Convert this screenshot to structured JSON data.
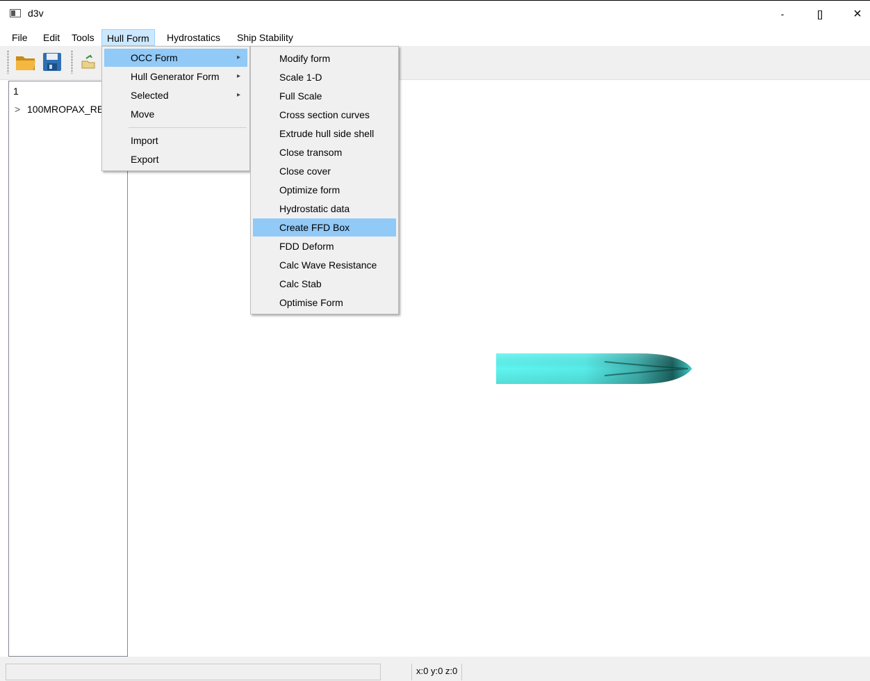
{
  "window": {
    "title": "d3v",
    "minimize": "-",
    "maximize": "[]",
    "close": "×"
  },
  "menubar": [
    "File",
    "Edit",
    "Tools",
    "Hull Form",
    "Hydrostatics",
    "Ship Stability"
  ],
  "tree": {
    "header": "1",
    "root_label": "100MROPAX_RE",
    "root_arrow": ">"
  },
  "hull_form_menu": {
    "items": [
      {
        "label": "OCC Form",
        "submenu": "▸"
      },
      {
        "label": "Hull Generator Form",
        "submenu": "▸"
      },
      {
        "label": "Selected",
        "submenu": "▸"
      },
      {
        "label": "Move"
      },
      {
        "label": "Import"
      },
      {
        "label": "Export"
      }
    ]
  },
  "occ_form_menu": {
    "items": [
      "Modify form",
      "Scale 1-D",
      "Full Scale",
      "Cross section curves",
      "Extrude hull side shell",
      "Close transom",
      "Close cover",
      "Optimize form",
      "Hydrostatic data",
      "Create FFD Box",
      "FDD Deform",
      "Calc Wave Resistance",
      "Calc Stab",
      "Optimise Form"
    ],
    "highlighted": "Create FFD Box"
  },
  "statusbar": {
    "coords": "x:0 y:0 z:0"
  },
  "colors": {
    "menu_highlight": "#91c9f7",
    "hull_fill": "#5ff5f0",
    "hull_dark": "#1a5f5c"
  }
}
